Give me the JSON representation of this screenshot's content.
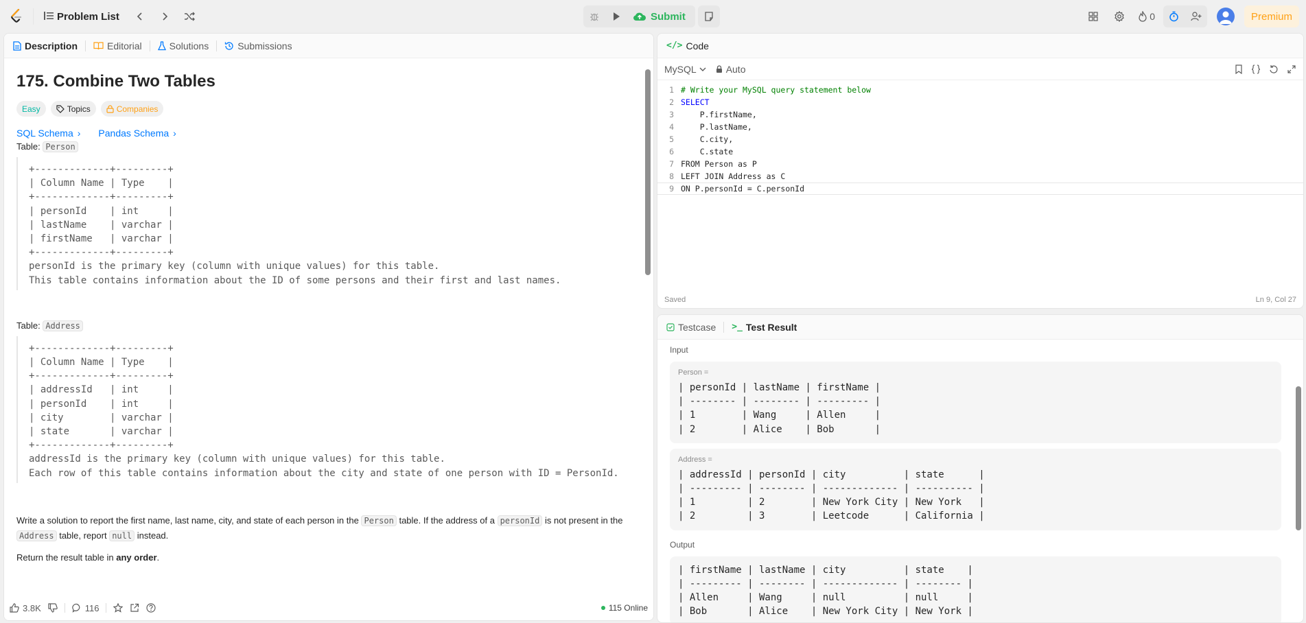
{
  "header": {
    "problem_list_label": "Problem List",
    "submit_label": "Submit",
    "streak_count": "0",
    "premium_label": "Premium"
  },
  "description_tabs": [
    {
      "label": "Description"
    },
    {
      "label": "Editorial"
    },
    {
      "label": "Solutions"
    },
    {
      "label": "Submissions"
    }
  ],
  "problem": {
    "title": "175. Combine Two Tables",
    "difficulty": "Easy",
    "topics_label": "Topics",
    "companies_label": "Companies",
    "sql_schema_label": "SQL Schema",
    "pandas_schema_label": "Pandas Schema",
    "table_prefix": "Table:",
    "person_table_name": "Person",
    "person_schema": "+-------------+---------+\n| Column Name | Type    |\n+-------------+---------+\n| personId    | int     |\n| lastName    | varchar |\n| firstName   | varchar |\n+-------------+---------+\npersonId is the primary key (column with unique values) for this table.\nThis table contains information about the ID of some persons and their first and last names.",
    "address_table_name": "Address",
    "address_schema": "+-------------+---------+\n| Column Name | Type    |\n+-------------+---------+\n| addressId   | int     |\n| personId    | int     |\n| city        | varchar |\n| state       | varchar |\n+-------------+---------+\naddressId is the primary key (column with unique values) for this table.\nEach row of this table contains information about the city and state of one person with ID = PersonId.",
    "statement_1": "Write a solution to report the first name, last name, city, and state of each person in the",
    "statement_code_person": "Person",
    "statement_2": "table. If the address of a",
    "statement_code_personid": "personId",
    "statement_3": "is not present in the",
    "statement_code_address": "Address",
    "statement_4": "table, report",
    "statement_code_null": "null",
    "statement_5": "instead.",
    "return_1": "Return the result table in",
    "return_bold": "any order",
    "return_2": "."
  },
  "footer": {
    "likes": "3.8K",
    "comments": "116",
    "online": "115 Online"
  },
  "code_panel": {
    "title": "Code",
    "language": "MySQL",
    "mode": "Auto",
    "saved_label": "Saved",
    "cursor_pos": "Ln 9, Col 27",
    "lines": [
      {
        "n": "1",
        "text": "# Write your MySQL query statement below"
      },
      {
        "n": "2",
        "text": "SELECT"
      },
      {
        "n": "3",
        "text": "    P.firstName,"
      },
      {
        "n": "4",
        "text": "    P.lastName,"
      },
      {
        "n": "5",
        "text": "    C.city,"
      },
      {
        "n": "6",
        "text": "    C.state"
      },
      {
        "n": "7",
        "text": "FROM Person as P"
      },
      {
        "n": "8",
        "text": "LEFT JOIN Address as C"
      },
      {
        "n": "9",
        "text": "ON P.personId = C.personId"
      }
    ]
  },
  "result_panel": {
    "testcase_tab": "Testcase",
    "result_tab": "Test Result",
    "input_label": "Input",
    "person_var": "Person =",
    "person_table": "| personId | lastName | firstName |\n| -------- | -------- | --------- |\n| 1        | Wang     | Allen     |\n| 2        | Alice    | Bob       |",
    "address_var": "Address =",
    "address_table": "| addressId | personId | city          | state      |\n| --------- | -------- | ------------- | ---------- |\n| 1         | 2        | New York City | New York   |\n| 2         | 3        | Leetcode      | California |",
    "output_label": "Output",
    "output_table": "| firstName | lastName | city          | state    |\n| --------- | -------- | ------------- | -------- |\n| Allen     | Wang     | null          | null     |\n| Bob       | Alice    | New York City | New York |"
  },
  "colors": {
    "accent_orange": "#ffa116",
    "submit_green": "#2db55d",
    "easy_teal": "#00b8a3",
    "link_blue": "#007aff"
  }
}
